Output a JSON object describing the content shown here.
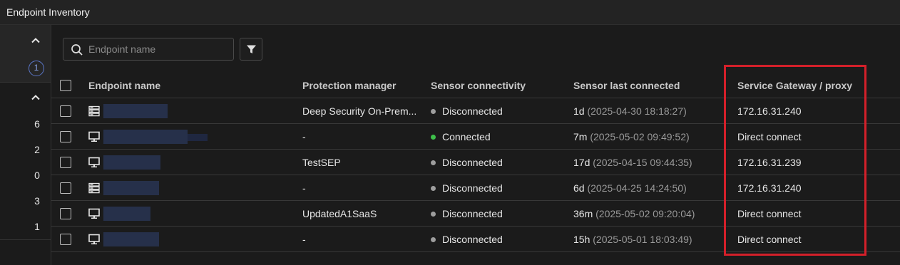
{
  "window": {
    "title": "Endpoint Inventory"
  },
  "left_rail": {
    "badge": "1",
    "counts": [
      "6",
      "2",
      "0",
      "3",
      "1"
    ]
  },
  "toolbar": {
    "search_placeholder": "Endpoint name"
  },
  "table": {
    "columns": [
      "Endpoint name",
      "Protection manager",
      "Sensor connectivity",
      "Sensor last connected",
      "Service Gateway / proxy"
    ],
    "rows": [
      {
        "device_icon": "server-icon",
        "protection_manager": "Deep Security On-Prem...",
        "connectivity": "Disconnected",
        "status_color": "#9e9e9e",
        "last_rel": "1d",
        "last_abs": "(2025-04-30 18:18:27)",
        "gateway": "172.16.31.240"
      },
      {
        "device_icon": "desktop-icon",
        "protection_manager": "-",
        "connectivity": "Connected",
        "status_color": "#3ec04a",
        "last_rel": "7m",
        "last_abs": "(2025-05-02 09:49:52)",
        "gateway": "Direct connect"
      },
      {
        "device_icon": "desktop-icon",
        "protection_manager": "TestSEP",
        "connectivity": "Disconnected",
        "status_color": "#9e9e9e",
        "last_rel": "17d",
        "last_abs": "(2025-04-15 09:44:35)",
        "gateway": "172.16.31.239"
      },
      {
        "device_icon": "server-icon",
        "protection_manager": "-",
        "connectivity": "Disconnected",
        "status_color": "#9e9e9e",
        "last_rel": "6d",
        "last_abs": "(2025-04-25 14:24:50)",
        "gateway": "172.16.31.240"
      },
      {
        "device_icon": "desktop-icon",
        "protection_manager": "UpdatedA1SaaS",
        "connectivity": "Disconnected",
        "status_color": "#9e9e9e",
        "last_rel": "36m",
        "last_abs": "(2025-05-02 09:20:04)",
        "gateway": "Direct connect"
      },
      {
        "device_icon": "desktop-icon",
        "protection_manager": "-",
        "connectivity": "Disconnected",
        "status_color": "#9e9e9e",
        "last_rel": "15h",
        "last_abs": "(2025-05-01 18:03:49)",
        "gateway": "Direct connect"
      }
    ]
  },
  "colors": {
    "highlight": "#d4202a",
    "badge": "#5b77c9",
    "connected": "#3ec04a",
    "disconnected": "#9e9e9e"
  }
}
